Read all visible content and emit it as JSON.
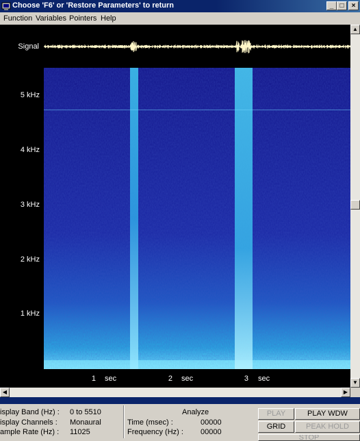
{
  "window": {
    "title": "Choose 'F6' or 'Restore Parameters' to return",
    "minimize": "_",
    "maximize": "□",
    "close": "×"
  },
  "menu": [
    "Function",
    "Variables",
    "Pointers",
    "Help"
  ],
  "plot": {
    "signal_label": "Signal",
    "freq_ticks": [
      "5 kHz",
      "4 kHz",
      "3 kHz",
      "2 kHz",
      "1 kHz"
    ],
    "time_ticks": [
      "1",
      "2",
      "3"
    ],
    "time_unit": "sec",
    "colors": {
      "background": "#000000",
      "waveform": "#fff6c8",
      "spectrogram_low": "#1a1fa8",
      "spectrogram_high": "#3fd6f0"
    }
  },
  "status": {
    "display_band_label": "isplay Band (Hz) :",
    "display_band_value": "0 to 5510",
    "display_channels_label": "isplay Channels :",
    "display_channels_value": "Monaural",
    "sample_rate_label": "ample Rate (Hz) :",
    "sample_rate_value": "11025",
    "analyze_title": "Analyze",
    "time_label": "Time (msec) :",
    "time_value": "00000",
    "frequency_label": "Frequency (Hz) :",
    "frequency_value": "00000"
  },
  "buttons": {
    "play": "PLAY",
    "play_wdw": "PLAY WDW",
    "grid": "GRID",
    "peak_hold": "PEAK HOLD",
    "stop": "STOP"
  }
}
